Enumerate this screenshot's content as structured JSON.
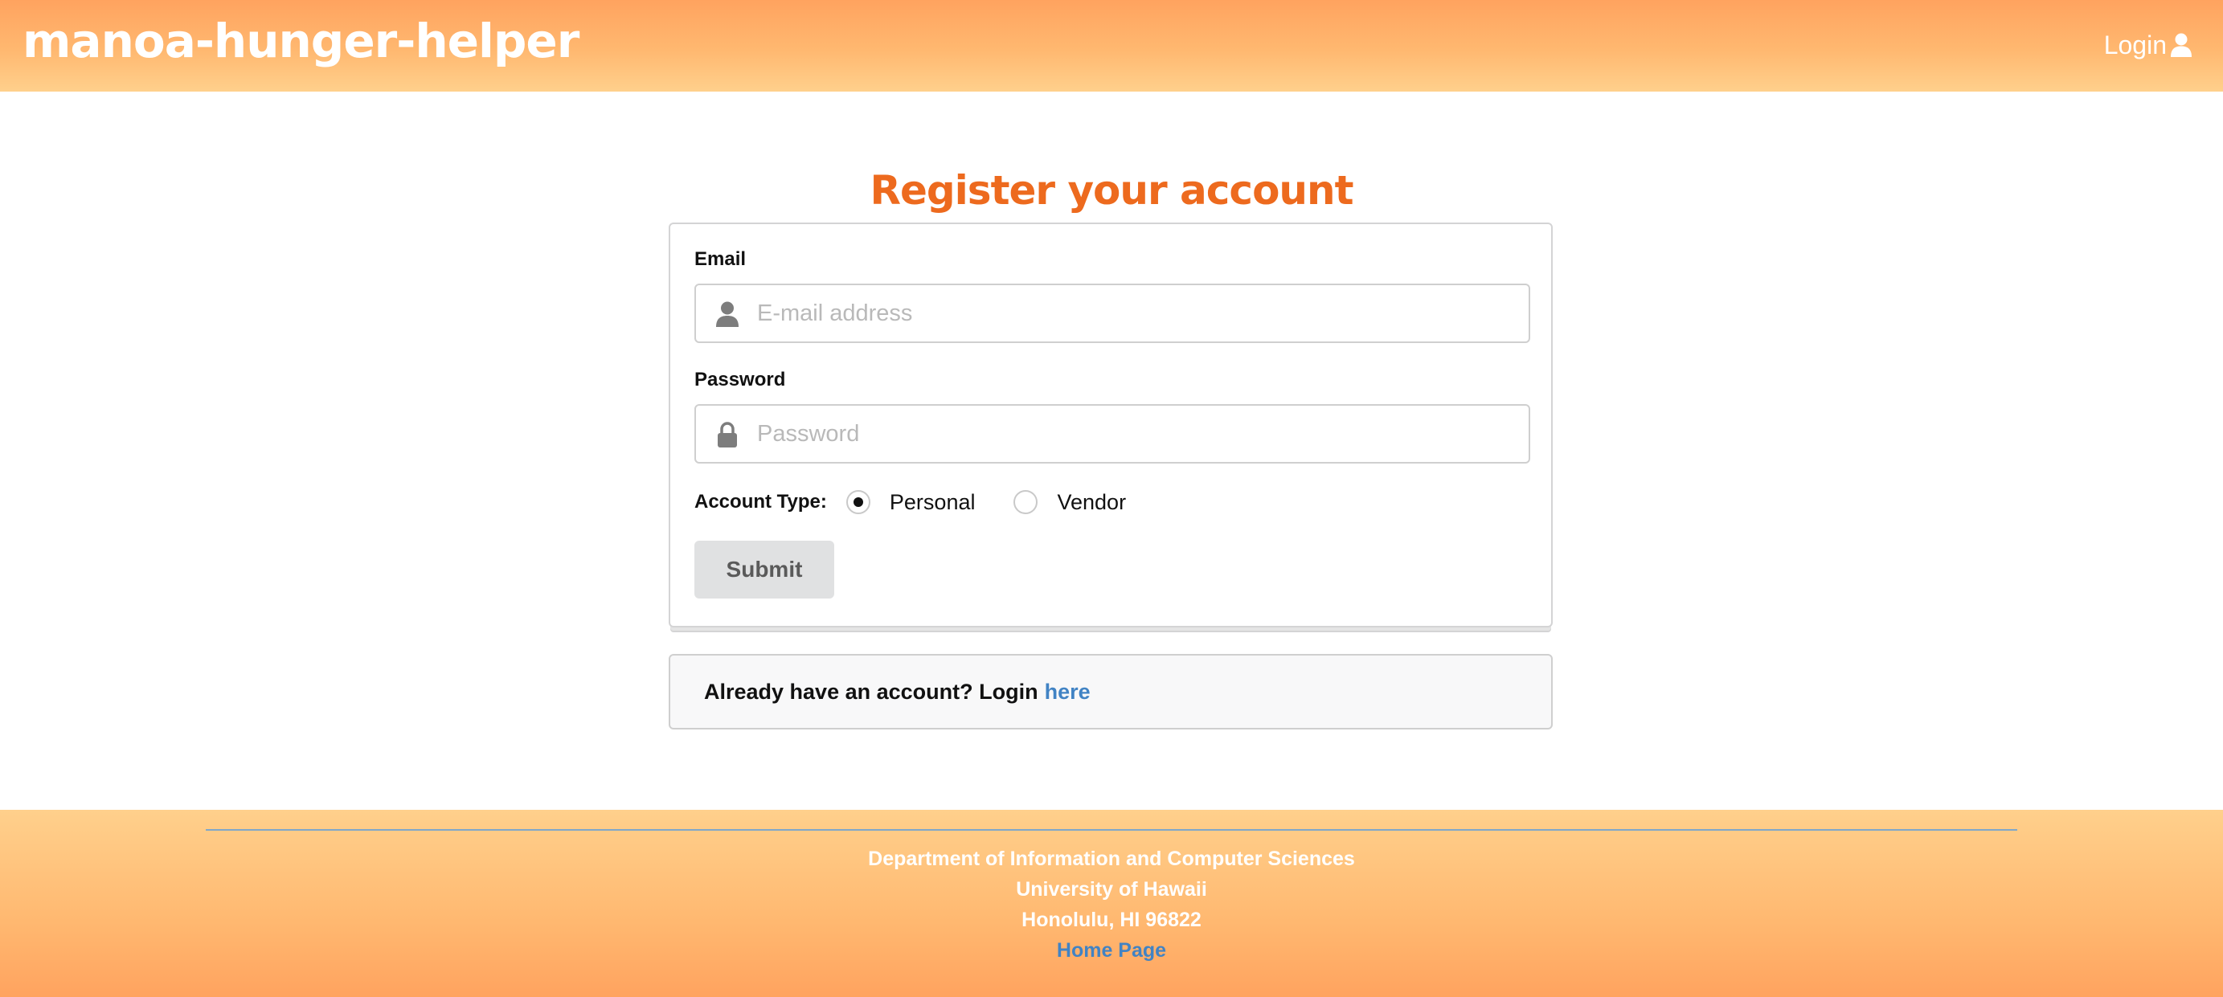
{
  "header": {
    "brand": "manoa-hunger-helper",
    "login_label": "Login",
    "login_icon": "user-icon"
  },
  "page": {
    "title": "Register your account"
  },
  "form": {
    "email_label": "Email",
    "email_placeholder": "E-mail address",
    "email_value": "",
    "email_icon": "user-icon",
    "password_label": "Password",
    "password_placeholder": "Password",
    "password_value": "",
    "password_icon": "lock-icon",
    "account_type_label": "Account Type:",
    "account_type_options": [
      {
        "label": "Personal",
        "selected": true
      },
      {
        "label": "Vendor",
        "selected": false
      }
    ],
    "submit_label": "Submit"
  },
  "login_prompt": {
    "text": "Already have an account? Login",
    "link": "here"
  },
  "footer": {
    "line1": "Department of Information and Computer Sciences",
    "line2": "University of Hawaii",
    "line3": "Honolulu, HI 96822",
    "link": "Home Page"
  },
  "colors": {
    "accent_orange": "#ed6a1e",
    "header_gradient_top": "#ffa35f",
    "header_gradient_bottom": "#ffd08c",
    "link_blue": "#4183c4"
  }
}
